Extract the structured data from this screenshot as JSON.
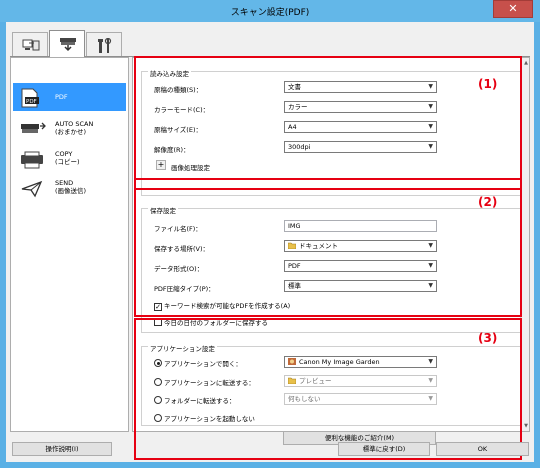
{
  "window": {
    "title": "スキャン設定(PDF)",
    "close_label": "✕"
  },
  "tabs": [
    {
      "icon": "scanner-to-pc-icon"
    },
    {
      "icon": "scanner-panel-icon"
    },
    {
      "icon": "tools-icon"
    }
  ],
  "sidebar": {
    "items": [
      {
        "label": "PDF",
        "icon": "pdf-document-icon"
      },
      {
        "label": "AUTO SCAN\n(おまかせ)",
        "icon": "auto-scan-icon"
      },
      {
        "label": "COPY\n(コピー)",
        "icon": "copy-icon"
      },
      {
        "label": "SEND\n(画像送信)",
        "icon": "send-icon"
      }
    ]
  },
  "scan_settings": {
    "title": "読み込み設定",
    "rows": [
      {
        "label": "原稿の種類(S)：",
        "value": "文書"
      },
      {
        "label": "カラーモード(C)：",
        "value": "カラー"
      },
      {
        "label": "原稿サイズ(E)：",
        "value": "A4"
      },
      {
        "label": "解像度(R)：",
        "value": "300dpi"
      }
    ],
    "image_processing_label": "画像処理設定",
    "plus_label": "+"
  },
  "save_settings": {
    "title": "保存設定",
    "filename_label": "ファイル名(F)：",
    "filename_value": "IMG",
    "location_label": "保存する場所(V)：",
    "location_value": "ドキュメント",
    "format_label": "データ形式(O)：",
    "format_value": "PDF",
    "compression_label": "PDF圧縮タイプ(P)：",
    "compression_value": "標準",
    "keyword_search_label": "キーワード検索が可能なPDFを作成する(A)",
    "keyword_search_checked": true,
    "today_folder_label": "今日の日付のフォルダーに保存する",
    "today_folder_checked": false
  },
  "app_settings": {
    "title": "アプリケーション設定",
    "open_app_label": "アプリケーションで開く：",
    "open_app_value": "Canon My Image Garden",
    "send_app_label": "アプリケーションに転送する：",
    "send_app_value": "プレビュー",
    "send_folder_label": "フォルダーに転送する：",
    "send_folder_value": "何もしない",
    "no_app_label": "アプリケーションを起動しない",
    "useful_features_label": "便利な機能のご紹介(M)",
    "selected_option": "open_app"
  },
  "markers": {
    "one": "(1)",
    "two": "(2)",
    "three": "(3)"
  },
  "buttons": {
    "instructions": "操作説明(I)",
    "defaults": "標準に戻す(D)",
    "ok": "OK"
  },
  "colors": {
    "selection": "#3399ff",
    "highlight_box": "#e60012",
    "titlebar": "#63b7e8",
    "close": "#c7504b"
  }
}
